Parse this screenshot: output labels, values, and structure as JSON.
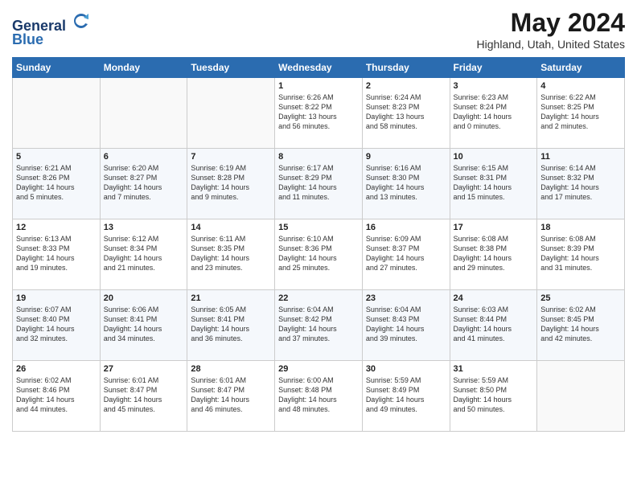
{
  "header": {
    "logo_line1": "General",
    "logo_line2": "Blue",
    "month": "May 2024",
    "location": "Highland, Utah, United States"
  },
  "weekdays": [
    "Sunday",
    "Monday",
    "Tuesday",
    "Wednesday",
    "Thursday",
    "Friday",
    "Saturday"
  ],
  "weeks": [
    [
      {
        "day": "",
        "text": ""
      },
      {
        "day": "",
        "text": ""
      },
      {
        "day": "",
        "text": ""
      },
      {
        "day": "1",
        "text": "Sunrise: 6:26 AM\nSunset: 8:22 PM\nDaylight: 13 hours\nand 56 minutes."
      },
      {
        "day": "2",
        "text": "Sunrise: 6:24 AM\nSunset: 8:23 PM\nDaylight: 13 hours\nand 58 minutes."
      },
      {
        "day": "3",
        "text": "Sunrise: 6:23 AM\nSunset: 8:24 PM\nDaylight: 14 hours\nand 0 minutes."
      },
      {
        "day": "4",
        "text": "Sunrise: 6:22 AM\nSunset: 8:25 PM\nDaylight: 14 hours\nand 2 minutes."
      }
    ],
    [
      {
        "day": "5",
        "text": "Sunrise: 6:21 AM\nSunset: 8:26 PM\nDaylight: 14 hours\nand 5 minutes."
      },
      {
        "day": "6",
        "text": "Sunrise: 6:20 AM\nSunset: 8:27 PM\nDaylight: 14 hours\nand 7 minutes."
      },
      {
        "day": "7",
        "text": "Sunrise: 6:19 AM\nSunset: 8:28 PM\nDaylight: 14 hours\nand 9 minutes."
      },
      {
        "day": "8",
        "text": "Sunrise: 6:17 AM\nSunset: 8:29 PM\nDaylight: 14 hours\nand 11 minutes."
      },
      {
        "day": "9",
        "text": "Sunrise: 6:16 AM\nSunset: 8:30 PM\nDaylight: 14 hours\nand 13 minutes."
      },
      {
        "day": "10",
        "text": "Sunrise: 6:15 AM\nSunset: 8:31 PM\nDaylight: 14 hours\nand 15 minutes."
      },
      {
        "day": "11",
        "text": "Sunrise: 6:14 AM\nSunset: 8:32 PM\nDaylight: 14 hours\nand 17 minutes."
      }
    ],
    [
      {
        "day": "12",
        "text": "Sunrise: 6:13 AM\nSunset: 8:33 PM\nDaylight: 14 hours\nand 19 minutes."
      },
      {
        "day": "13",
        "text": "Sunrise: 6:12 AM\nSunset: 8:34 PM\nDaylight: 14 hours\nand 21 minutes."
      },
      {
        "day": "14",
        "text": "Sunrise: 6:11 AM\nSunset: 8:35 PM\nDaylight: 14 hours\nand 23 minutes."
      },
      {
        "day": "15",
        "text": "Sunrise: 6:10 AM\nSunset: 8:36 PM\nDaylight: 14 hours\nand 25 minutes."
      },
      {
        "day": "16",
        "text": "Sunrise: 6:09 AM\nSunset: 8:37 PM\nDaylight: 14 hours\nand 27 minutes."
      },
      {
        "day": "17",
        "text": "Sunrise: 6:08 AM\nSunset: 8:38 PM\nDaylight: 14 hours\nand 29 minutes."
      },
      {
        "day": "18",
        "text": "Sunrise: 6:08 AM\nSunset: 8:39 PM\nDaylight: 14 hours\nand 31 minutes."
      }
    ],
    [
      {
        "day": "19",
        "text": "Sunrise: 6:07 AM\nSunset: 8:40 PM\nDaylight: 14 hours\nand 32 minutes."
      },
      {
        "day": "20",
        "text": "Sunrise: 6:06 AM\nSunset: 8:41 PM\nDaylight: 14 hours\nand 34 minutes."
      },
      {
        "day": "21",
        "text": "Sunrise: 6:05 AM\nSunset: 8:41 PM\nDaylight: 14 hours\nand 36 minutes."
      },
      {
        "day": "22",
        "text": "Sunrise: 6:04 AM\nSunset: 8:42 PM\nDaylight: 14 hours\nand 37 minutes."
      },
      {
        "day": "23",
        "text": "Sunrise: 6:04 AM\nSunset: 8:43 PM\nDaylight: 14 hours\nand 39 minutes."
      },
      {
        "day": "24",
        "text": "Sunrise: 6:03 AM\nSunset: 8:44 PM\nDaylight: 14 hours\nand 41 minutes."
      },
      {
        "day": "25",
        "text": "Sunrise: 6:02 AM\nSunset: 8:45 PM\nDaylight: 14 hours\nand 42 minutes."
      }
    ],
    [
      {
        "day": "26",
        "text": "Sunrise: 6:02 AM\nSunset: 8:46 PM\nDaylight: 14 hours\nand 44 minutes."
      },
      {
        "day": "27",
        "text": "Sunrise: 6:01 AM\nSunset: 8:47 PM\nDaylight: 14 hours\nand 45 minutes."
      },
      {
        "day": "28",
        "text": "Sunrise: 6:01 AM\nSunset: 8:47 PM\nDaylight: 14 hours\nand 46 minutes."
      },
      {
        "day": "29",
        "text": "Sunrise: 6:00 AM\nSunset: 8:48 PM\nDaylight: 14 hours\nand 48 minutes."
      },
      {
        "day": "30",
        "text": "Sunrise: 5:59 AM\nSunset: 8:49 PM\nDaylight: 14 hours\nand 49 minutes."
      },
      {
        "day": "31",
        "text": "Sunrise: 5:59 AM\nSunset: 8:50 PM\nDaylight: 14 hours\nand 50 minutes."
      },
      {
        "day": "",
        "text": ""
      }
    ]
  ]
}
